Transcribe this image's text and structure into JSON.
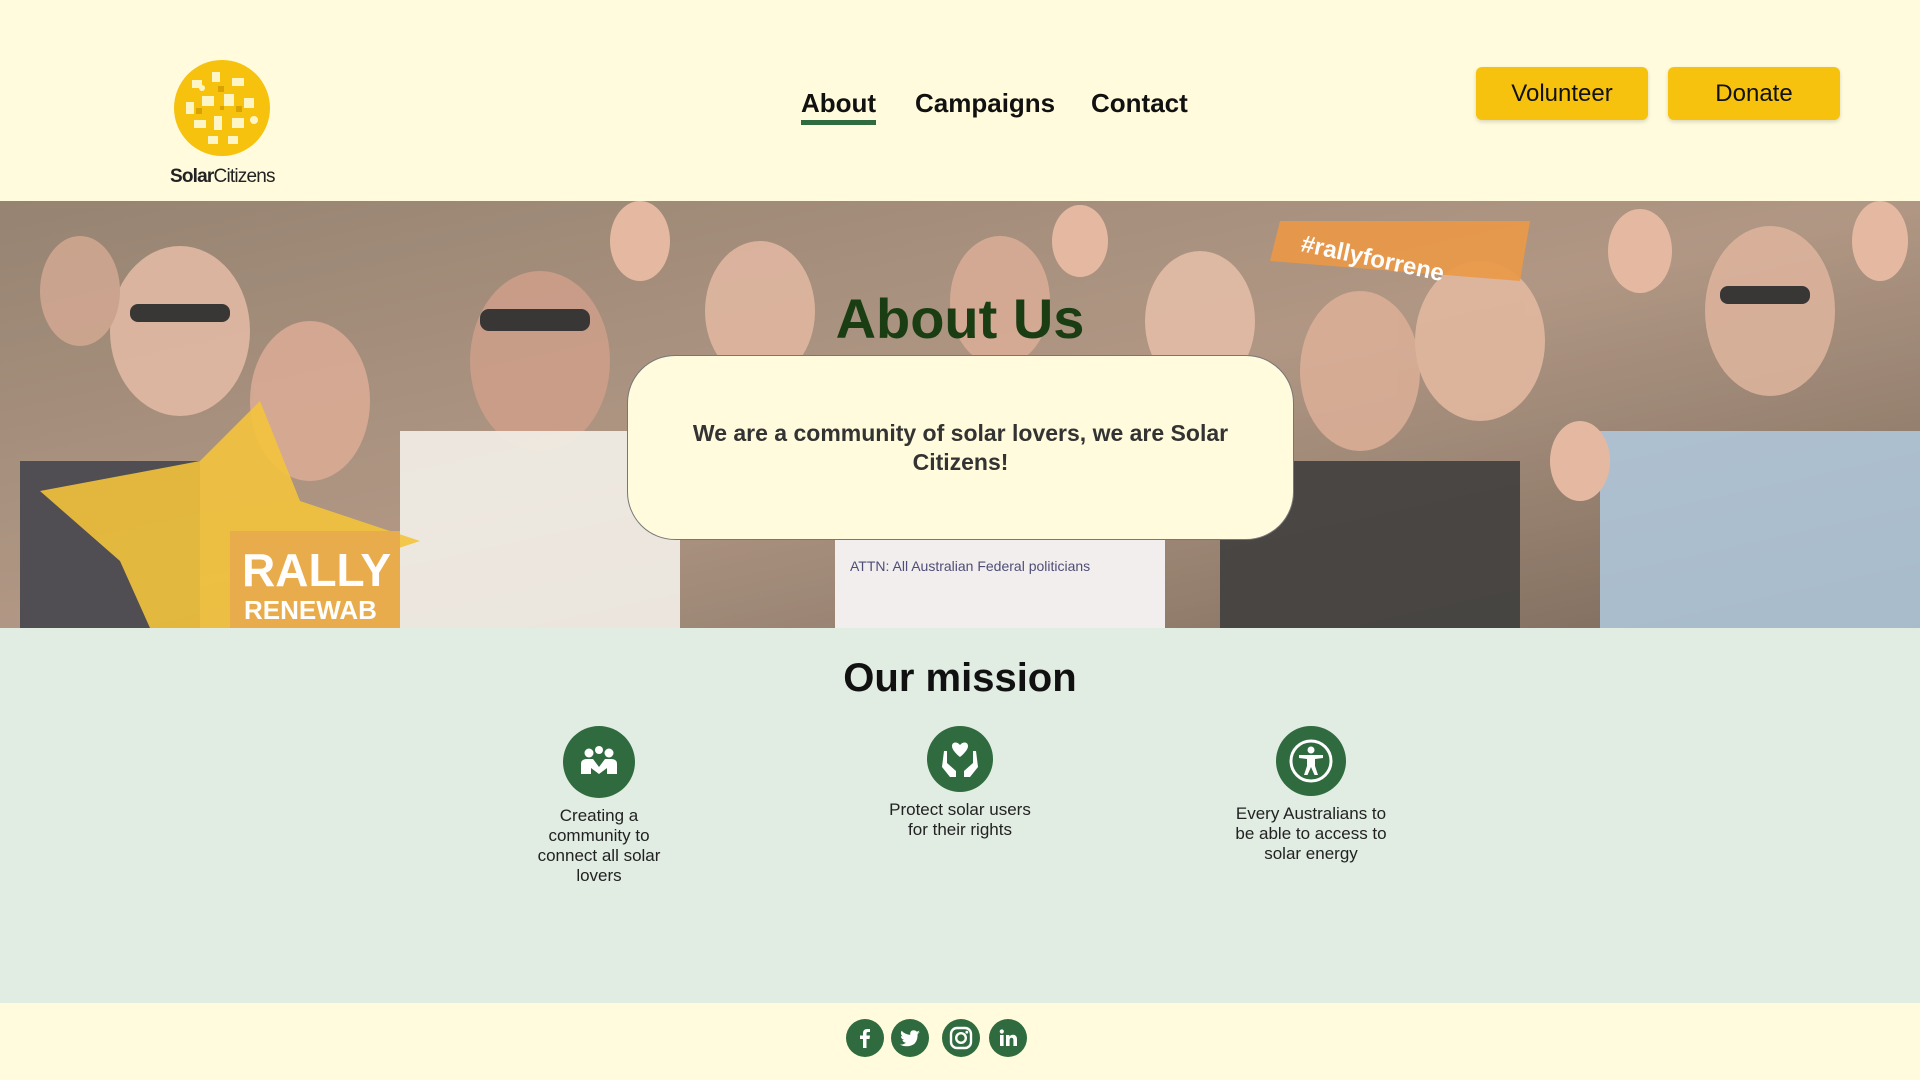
{
  "brand": {
    "logo_text_bold": "Solar",
    "logo_text_regular": "Citizens",
    "accent": "#f6c20e",
    "primary_green": "#2f6b3e",
    "background": "#fffbdc"
  },
  "nav": {
    "items": [
      {
        "label": "About",
        "active": true
      },
      {
        "label": "Campaigns",
        "active": false
      },
      {
        "label": "Contact",
        "active": false
      }
    ]
  },
  "actions": {
    "volunteer_label": "Volunteer",
    "donate_label": "Donate"
  },
  "hero": {
    "title": "About Us",
    "card_text": "We are a community of solar lovers, we are Solar Citizens!"
  },
  "mission": {
    "title": "Our mission",
    "items": [
      {
        "icon": "community-icon",
        "text": "Creating a community to connect all solar lovers"
      },
      {
        "icon": "heart-hands-icon",
        "text": "Protect solar users for their rights"
      },
      {
        "icon": "accessibility-icon",
        "text": "Every Australians to be able to access to solar energy"
      }
    ]
  },
  "footer": {
    "social": [
      "facebook-icon",
      "twitter-icon",
      "instagram-icon",
      "linkedin-icon"
    ]
  }
}
